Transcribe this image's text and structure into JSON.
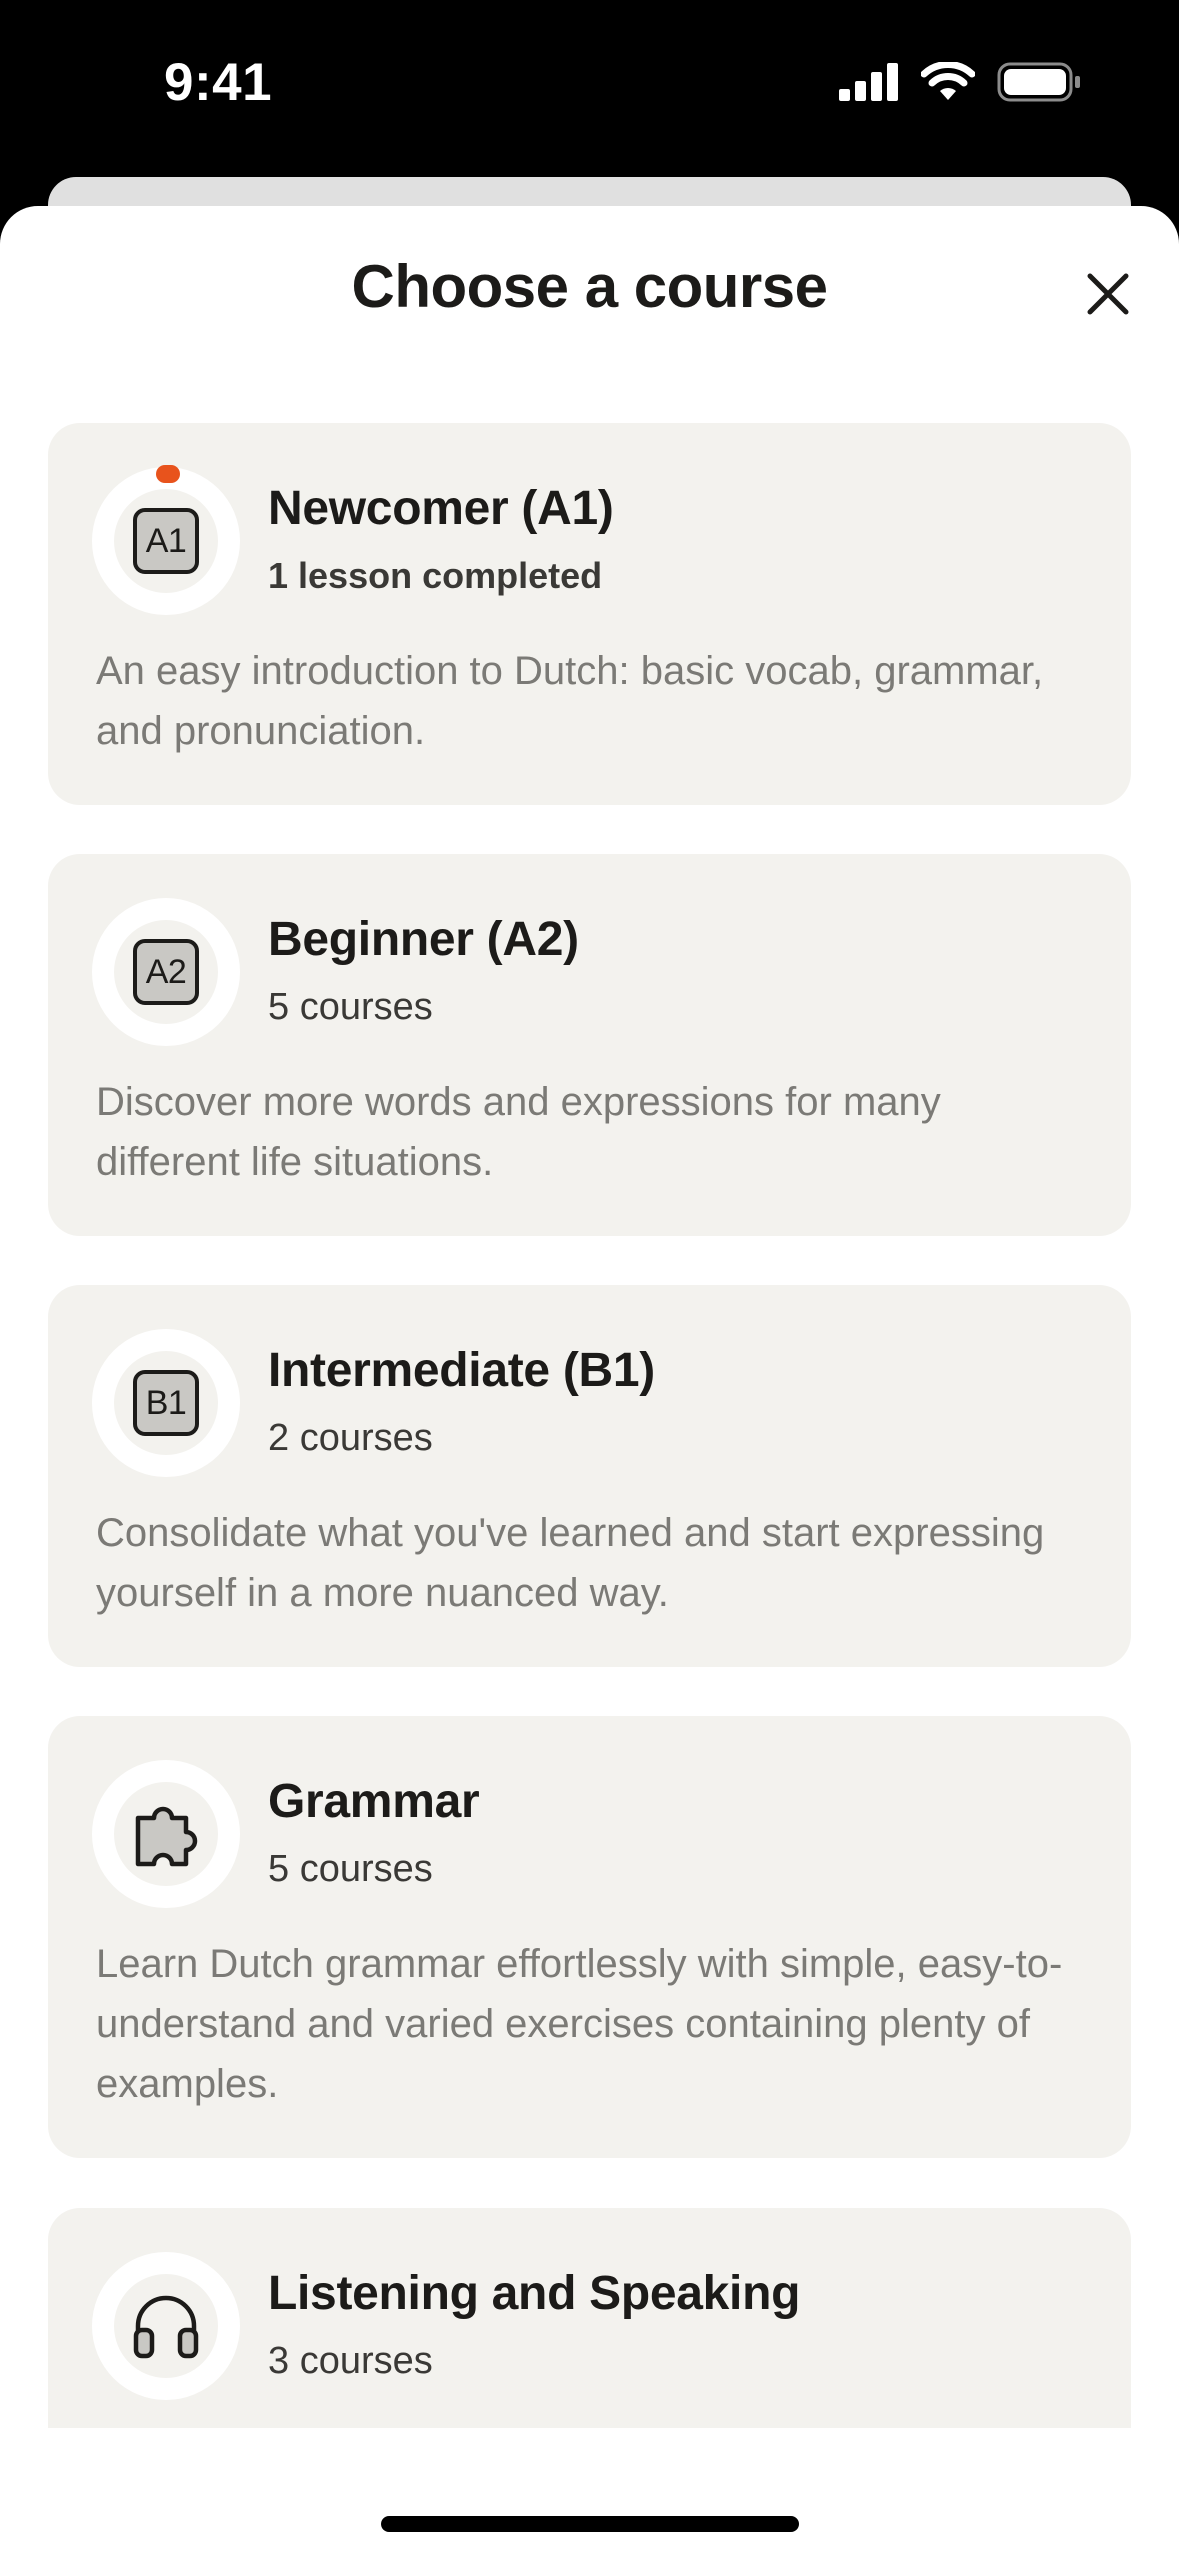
{
  "status_bar": {
    "time": "9:41"
  },
  "header": {
    "title": "Choose a course"
  },
  "courses": [
    {
      "icon": "level-badge-icon",
      "badge": "A1",
      "title": "Newcomer (A1)",
      "subtitle": "1 lesson completed",
      "description": "An easy introduction to Dutch: basic vocab, grammar, and pronunciation.",
      "has_progress_dot": true
    },
    {
      "icon": "level-badge-icon",
      "badge": "A2",
      "title": "Beginner (A2)",
      "subtitle": "5 courses",
      "description": "Discover more words and expressions for many different life situations."
    },
    {
      "icon": "level-badge-icon",
      "badge": "B1",
      "title": "Intermediate (B1)",
      "subtitle": "2 courses",
      "description": "Consolidate what you've learned and start expressing yourself in a more nuanced way."
    },
    {
      "icon": "puzzle-piece-icon",
      "title": "Grammar",
      "subtitle": "5 courses",
      "description": "Learn Dutch grammar effortlessly with simple, easy-to-understand and varied exercises containing plenty of examples."
    },
    {
      "icon": "headphones-icon",
      "title": "Listening and Speaking",
      "subtitle": "3 courses",
      "description": ""
    }
  ],
  "colors": {
    "card_background": "#f3f2ee",
    "progress_dot": "#e8531c",
    "text_primary": "#1c1b19",
    "text_secondary": "#7b7a76"
  }
}
